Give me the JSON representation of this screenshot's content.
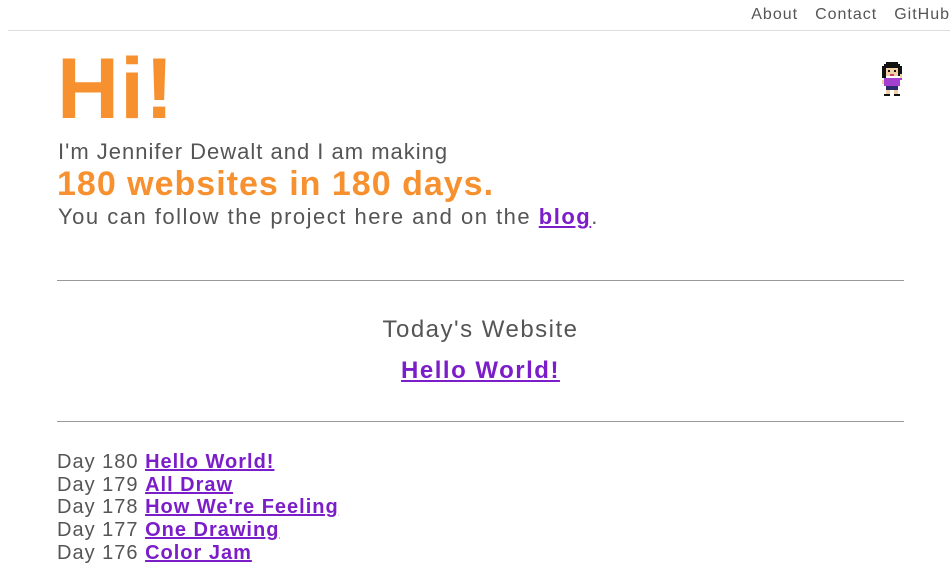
{
  "nav": {
    "links": [
      "About",
      "Contact",
      "GitHub"
    ]
  },
  "hero": {
    "greeting": "Hi!",
    "line1": "I'm Jennifer Dewalt and I am making",
    "line2": "180 websites in 180 days.",
    "line3_prefix": "You can follow the project here and on the ",
    "line3_link": "blog",
    "line3_suffix": "."
  },
  "today": {
    "label": "Today's Website",
    "site": "Hello World!"
  },
  "days": [
    {
      "day": "Day 180",
      "title": "Hello World!"
    },
    {
      "day": "Day 179",
      "title": "All Draw"
    },
    {
      "day": "Day 178",
      "title": "How We're Feeling"
    },
    {
      "day": "Day 177",
      "title": "One Drawing"
    },
    {
      "day": "Day 176",
      "title": "Color Jam"
    }
  ],
  "colors": {
    "accent_orange": "#f7912f",
    "link_purple": "#7b1ec9",
    "text_gray": "#555555"
  }
}
